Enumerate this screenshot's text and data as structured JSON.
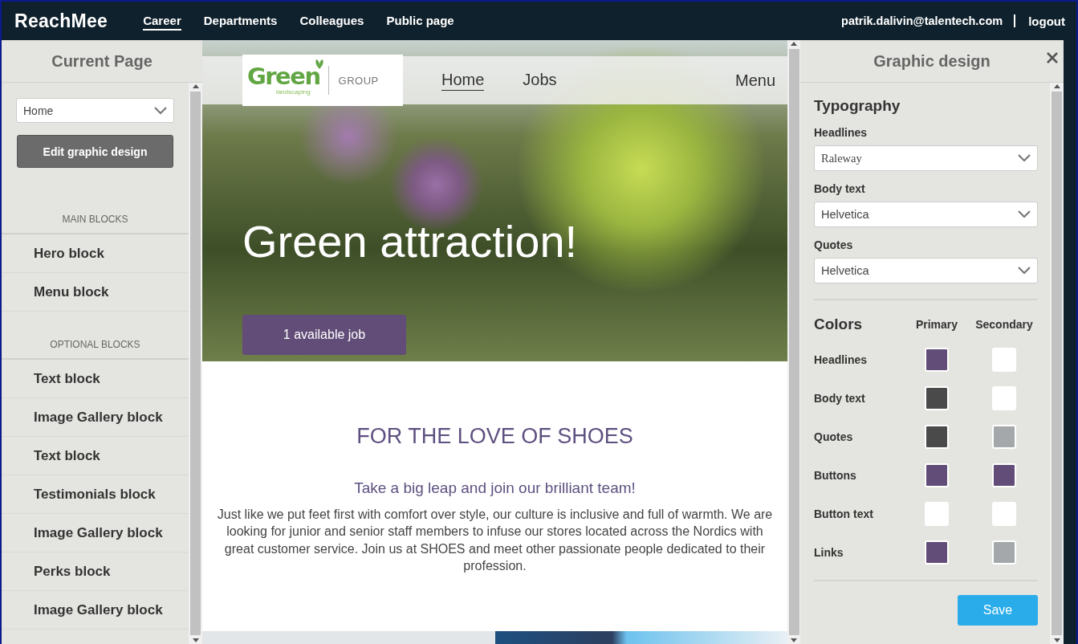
{
  "topbar": {
    "logo": "ReachMee",
    "nav": [
      {
        "label": "Career",
        "selected": true
      },
      {
        "label": "Departments",
        "selected": false
      },
      {
        "label": "Colleagues",
        "selected": false
      },
      {
        "label": "Public page",
        "selected": false
      }
    ],
    "user": "patrik.dalivin@talentech.com",
    "logout": "logout"
  },
  "left_panel": {
    "title": "Current Page",
    "page_select": {
      "value": "Home"
    },
    "edit_button": "Edit graphic design",
    "sections": [
      {
        "heading": "MAIN BLOCKS",
        "items": [
          "Hero block",
          "Menu block"
        ]
      },
      {
        "heading": "OPTIONAL BLOCKS",
        "items": [
          "Text block",
          "Image Gallery block",
          "Text block",
          "Testimonials block",
          "Image Gallery block",
          "Perks block",
          "Image Gallery block"
        ]
      }
    ]
  },
  "preview": {
    "logo": {
      "brand": "Green",
      "tagline": "landscaping",
      "group": "GROUP"
    },
    "nav": [
      {
        "label": "Home",
        "selected": true
      },
      {
        "label": "Jobs",
        "selected": false
      }
    ],
    "menu": "Menu",
    "hero_title": "Green attraction!",
    "hero_button": "1 available job",
    "heading": "FOR THE LOVE OF SHOES",
    "subheading": "Take a big leap and join our brilliant team!",
    "body": "Just like we put feet first with comfort over style, our culture is inclusive and full of warmth. We are looking for junior and senior staff members to infuse our stores located across the Nordics with great customer service. Join us at SHOES and meet other passionate people dedicated to their profession."
  },
  "right_panel": {
    "title": "Graphic design",
    "typography_title": "Typography",
    "fonts": [
      {
        "label": "Headlines",
        "value": "Raleway"
      },
      {
        "label": "Body text",
        "value": "Helvetica"
      },
      {
        "label": "Quotes",
        "value": "Helvetica"
      }
    ],
    "colors_title": "Colors",
    "primary_header": "Primary",
    "secondary_header": "Secondary",
    "colors": [
      {
        "label": "Headlines",
        "swatches": [
          {
            "color": "#624c78"
          },
          {
            "color": "#ffffff"
          }
        ]
      },
      {
        "label": "Body text",
        "swatches": [
          {
            "color": "#4a4a4a"
          },
          {
            "color": "#ffffff"
          }
        ]
      },
      {
        "label": "Quotes",
        "swatches": [
          {
            "color": "#4a4a4a"
          },
          {
            "color": "#a4a8ab"
          }
        ]
      },
      {
        "label": "Buttons",
        "swatches": [
          {
            "color": "#624c78"
          },
          {
            "color": "#624c78"
          }
        ]
      },
      {
        "label": "Button text",
        "swatches": [
          {
            "color": "#ffffff"
          },
          {
            "color": "#ffffff"
          }
        ]
      },
      {
        "label": "Links",
        "swatches": [
          {
            "color": "#624c78"
          },
          {
            "color": "#a4a8ab"
          }
        ]
      }
    ],
    "save": "Save"
  }
}
